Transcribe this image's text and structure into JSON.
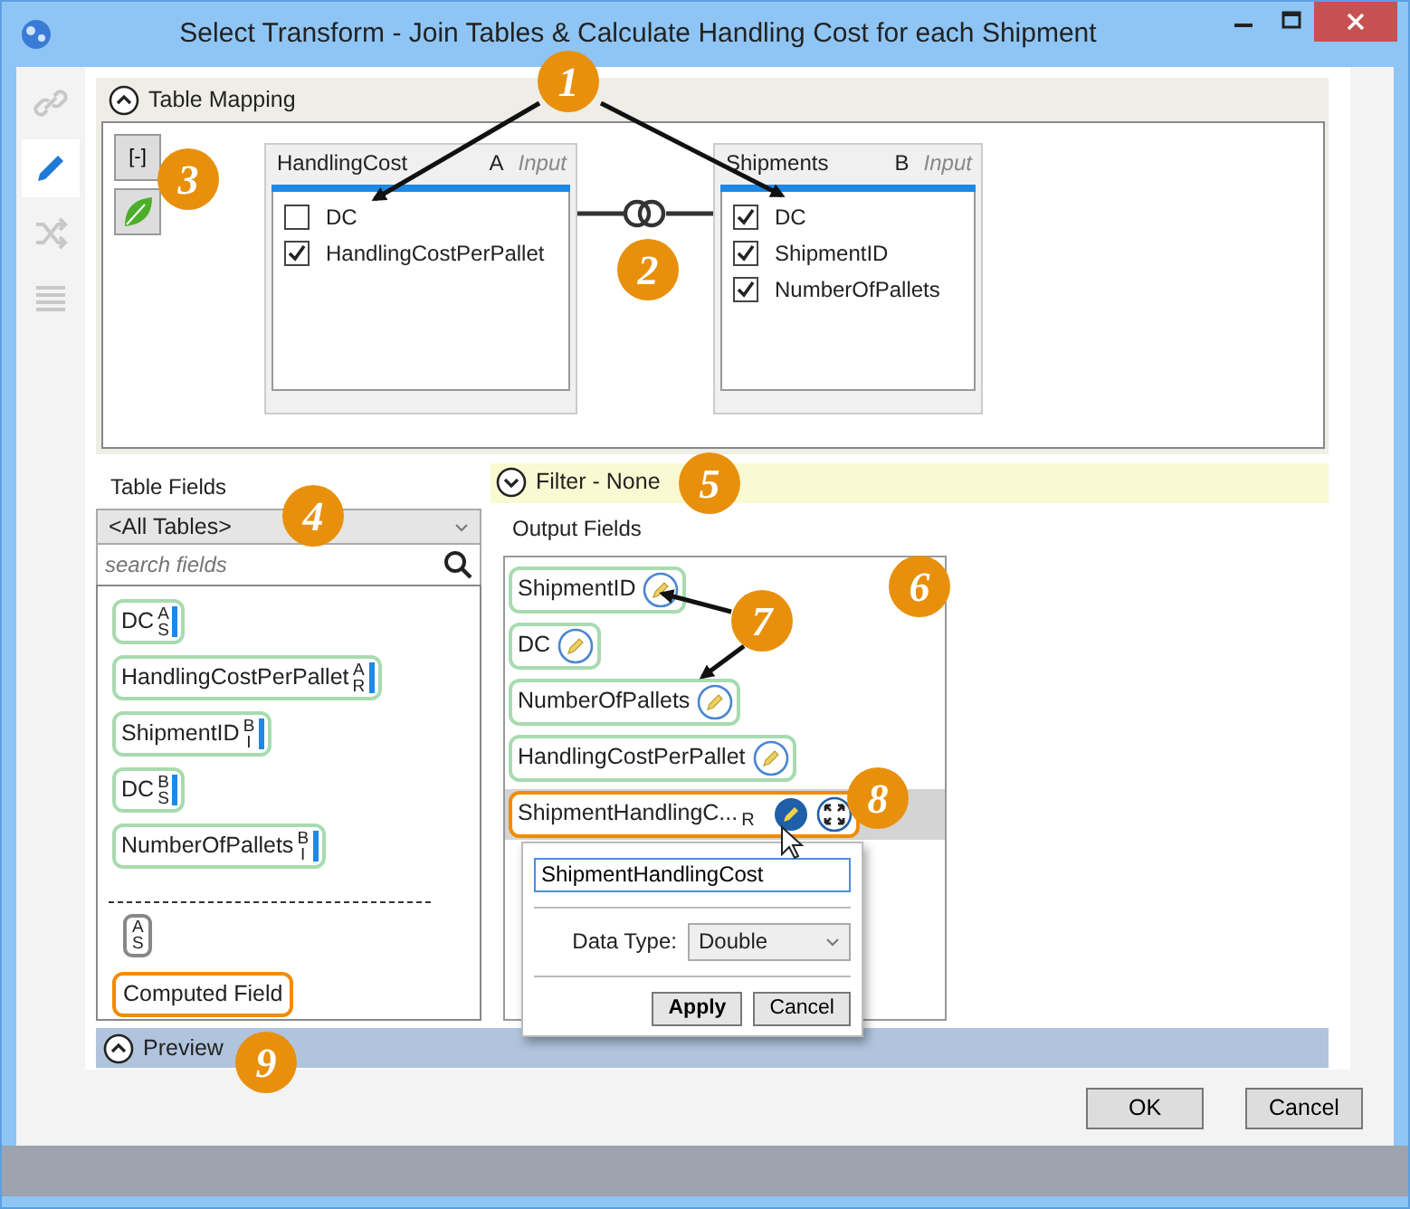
{
  "window": {
    "title": "Select Transform - Join Tables & Calculate Handling Cost for each Shipment"
  },
  "sidebar": [
    {
      "kind": "link",
      "selected": false
    },
    {
      "kind": "edit",
      "selected": true
    },
    {
      "kind": "shuffle",
      "selected": false
    },
    {
      "kind": "list",
      "selected": false
    }
  ],
  "table_mapping": {
    "title": "Table Mapping",
    "expanded": true,
    "collapse_button": "[-]",
    "tables": [
      {
        "name": "HandlingCost",
        "alias": "A",
        "role": "Input",
        "fields": [
          {
            "name": "DC",
            "checked": false
          },
          {
            "name": "HandlingCostPerPallet",
            "checked": true
          }
        ]
      },
      {
        "name": "Shipments",
        "alias": "B",
        "role": "Input",
        "fields": [
          {
            "name": "DC",
            "checked": true
          },
          {
            "name": "ShipmentID",
            "checked": true
          },
          {
            "name": "NumberOfPallets",
            "checked": true
          }
        ]
      }
    ]
  },
  "table_fields": {
    "title": "Table Fields",
    "dropdown": "<All Tables>",
    "search": {
      "placeholder": "search fields"
    },
    "fields": [
      {
        "name": "DC",
        "table": "A",
        "type": "S"
      },
      {
        "name": "HandlingCostPerPallet",
        "table": "A",
        "type": "R"
      },
      {
        "name": "ShipmentID",
        "table": "B",
        "type": "I"
      },
      {
        "name": "DC",
        "table": "B",
        "type": "S"
      },
      {
        "name": "NumberOfPallets",
        "table": "B",
        "type": "I"
      }
    ],
    "template": {
      "table": "A",
      "type": "S"
    },
    "computed_field": "Computed Field"
  },
  "filter": {
    "label": "Filter - None",
    "expanded": false
  },
  "output_fields": {
    "title": "Output Fields",
    "fields": [
      {
        "name": "ShipmentID",
        "kind": "source",
        "selected": false
      },
      {
        "name": "DC",
        "kind": "source",
        "selected": false
      },
      {
        "name": "NumberOfPallets",
        "kind": "source",
        "selected": false
      },
      {
        "name": "HandlingCostPerPallet",
        "kind": "source",
        "selected": false
      },
      {
        "name": "ShipmentHandlingC...",
        "kind": "computed",
        "type": "R",
        "selected": true
      }
    ],
    "popup": {
      "name": "ShipmentHandlingCost",
      "data_type_label": "Data Type:",
      "data_type": "Double",
      "apply": "Apply",
      "cancel": "Cancel"
    }
  },
  "preview": {
    "label": "Preview",
    "expanded": true
  },
  "buttons": [
    "OK",
    "Cancel"
  ],
  "callouts": [
    "1",
    "2",
    "3",
    "4",
    "5",
    "6",
    "7",
    "8",
    "9"
  ]
}
